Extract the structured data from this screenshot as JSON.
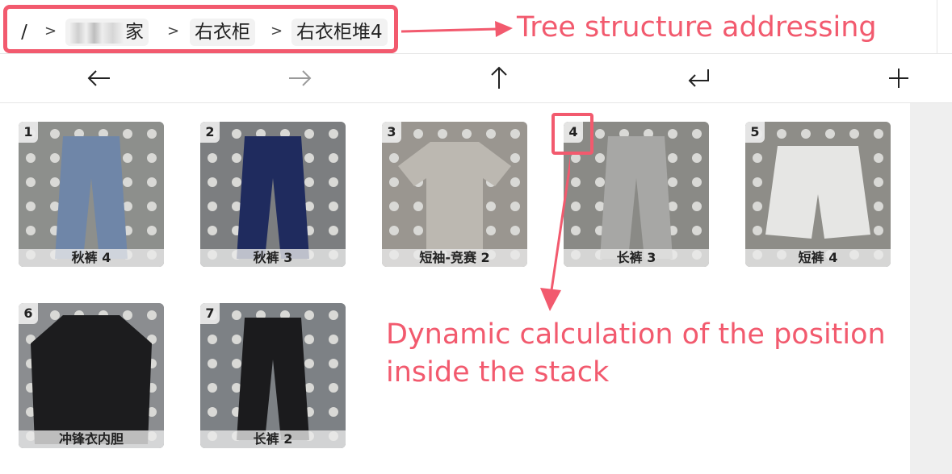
{
  "breadcrumb": {
    "root": "/",
    "separator": ">",
    "items": [
      "家",
      "右衣柜",
      "右衣柜堆4"
    ]
  },
  "annotations": {
    "tree": "Tree structure addressing",
    "dynamic_line1": "Dynamic calculation of the position",
    "dynamic_line2": "inside the stack",
    "color": "#f25a6e"
  },
  "toolbar": {
    "buttons": [
      {
        "name": "back",
        "icon": "arrow-left-icon",
        "glyph": "←"
      },
      {
        "name": "forward",
        "icon": "arrow-right-icon",
        "glyph": "→"
      },
      {
        "name": "up",
        "icon": "arrow-up-icon",
        "glyph": "↑"
      },
      {
        "name": "enter",
        "icon": "return-icon",
        "glyph": "↵"
      },
      {
        "name": "add",
        "icon": "plus-icon",
        "glyph": "+"
      }
    ]
  },
  "items": [
    {
      "num": "1",
      "label": "秋裤 4",
      "kind": "pants",
      "color": "#6f86a8",
      "bg": "#8d8f8c"
    },
    {
      "num": "2",
      "label": "秋裤 3",
      "kind": "pants",
      "color": "#1f2b5e",
      "bg": "#7c7e80"
    },
    {
      "num": "3",
      "label": "短袖-竞赛 2",
      "kind": "shirt",
      "color": "#bcb8b1",
      "bg": "#9a9690"
    },
    {
      "num": "4",
      "label": "长裤 3",
      "kind": "pants",
      "color": "#a7a7a5",
      "bg": "#8a8a86"
    },
    {
      "num": "5",
      "label": "短裤 4",
      "kind": "shorts",
      "color": "#e6e6e4",
      "bg": "#8e8d88"
    },
    {
      "num": "6",
      "label": "冲锋衣内胆",
      "kind": "jacket",
      "color": "#1c1c1e",
      "bg": "#8b8d90"
    },
    {
      "num": "7",
      "label": "长裤 2",
      "kind": "pants",
      "color": "#1b1b1d",
      "bg": "#7d8185"
    }
  ]
}
